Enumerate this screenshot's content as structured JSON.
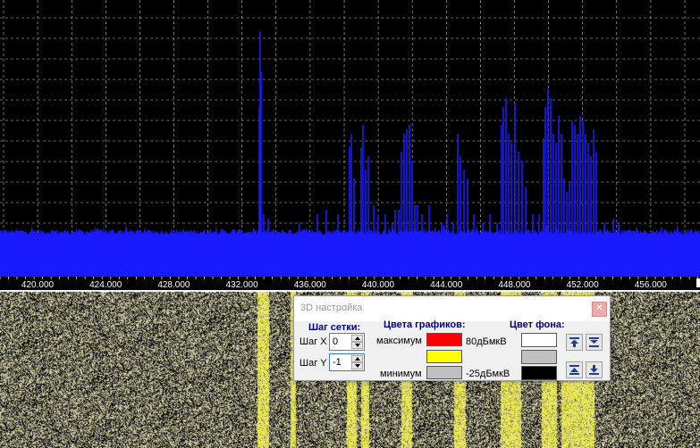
{
  "spectrum": {
    "freq_labels": [
      "420.000",
      "424.000",
      "428.000",
      "432.000",
      "436.000",
      "440.000",
      "444.000",
      "448.000",
      "452.000",
      "456.000"
    ],
    "colors": {
      "background": "#000000",
      "trace": "#1a1aff",
      "grid": "#bbbbbb",
      "axis_bar": "#000000"
    }
  },
  "waterfall": {
    "colors": {
      "noise_base": "#a8a48c",
      "signal": "#e8e840"
    }
  },
  "dialog": {
    "title": "3D настройка",
    "close_glyph": "✕",
    "grid_step": {
      "header": "Шаг сетки:",
      "x_label": "Шаг X",
      "x_value": "0",
      "y_label": "Шаг Y",
      "y_value": "-1"
    },
    "graph_colors": {
      "header": "Цвета графиков:",
      "max_label": "максимум",
      "min_label": "минимум",
      "max_color": "#ff0000",
      "mid_color": "#ffff00",
      "min_color": "#c0c0c0",
      "max_value": "80дБмкВ",
      "min_value": "-25дБмкВ"
    },
    "background_color": {
      "header": "Цвет фона:",
      "colors": [
        "#ffffff",
        "#c0c0c0",
        "#000000"
      ]
    },
    "icons": [
      "move-top-icon",
      "collapse-down-icon",
      "expand-up-icon",
      "move-bottom-icon"
    ]
  }
}
